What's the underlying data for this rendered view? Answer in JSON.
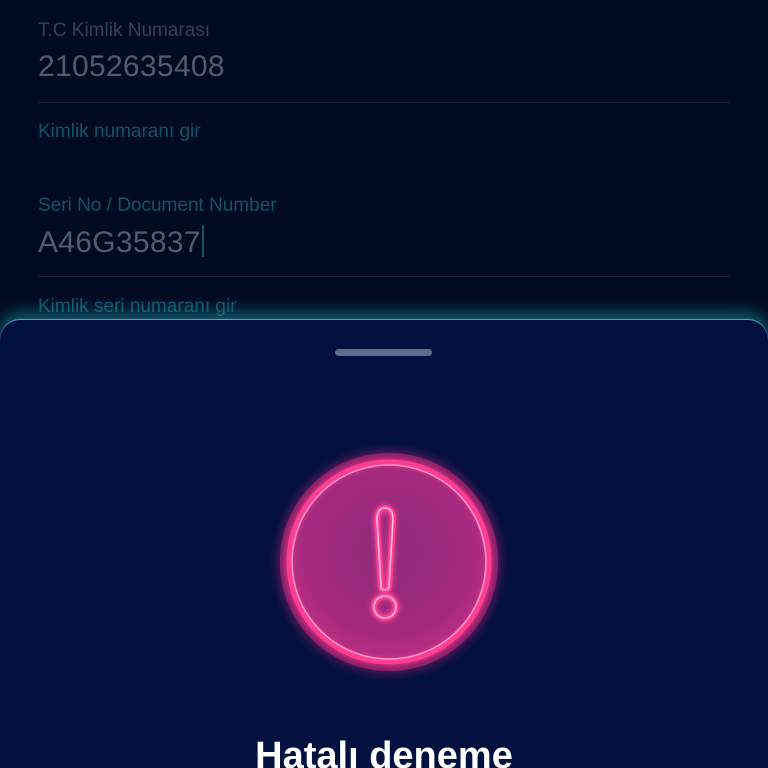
{
  "form": {
    "tc_field": {
      "label": "T.C Kimlik Numarası",
      "value": "21052635408",
      "hint": "Kimlik numaranı gir"
    },
    "serial_field": {
      "label": "Seri No / Document Number",
      "value": "A46G35837",
      "hint": "Kimlik seri numaranı gir"
    }
  },
  "sheet": {
    "icon": "exclamation-alert-icon",
    "title": "Hatalı deneme"
  },
  "colors": {
    "background": "#000a20",
    "sheet": "#02103f",
    "accent": "#27b7c9",
    "alert": "#ff2d8a"
  }
}
